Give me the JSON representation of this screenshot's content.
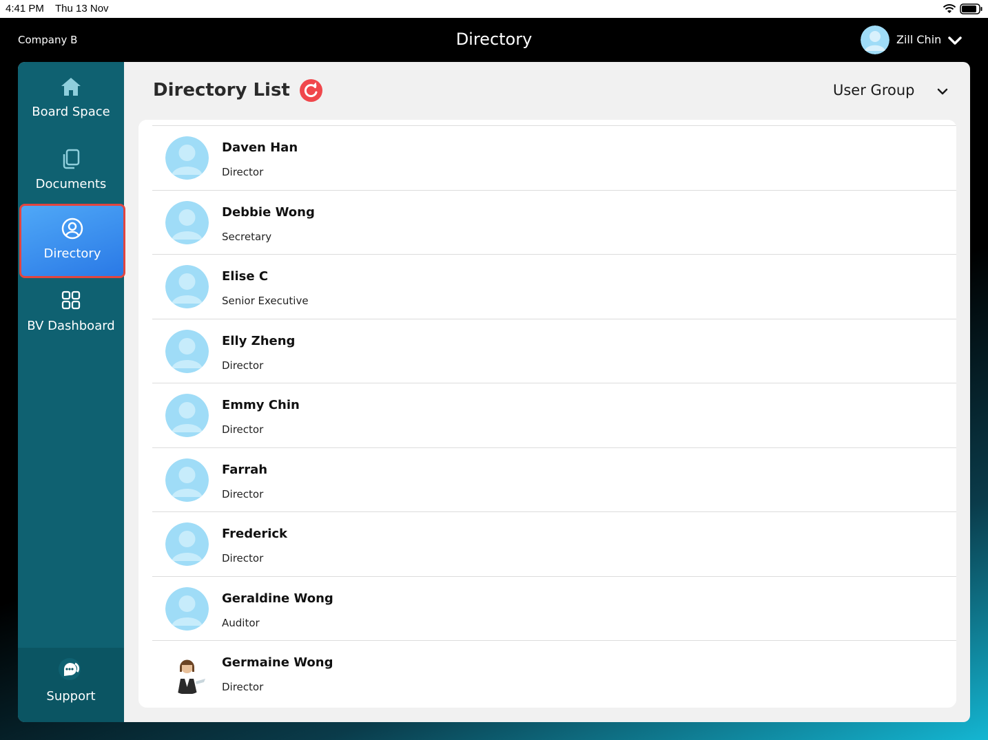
{
  "status_bar": {
    "time": "4:41 PM",
    "date": "Thu 13 Nov"
  },
  "header": {
    "company": "Company B",
    "title": "Directory",
    "user_name": "Zill Chin"
  },
  "sidebar": {
    "items": [
      {
        "label": "Board Space",
        "icon": "home-icon",
        "active": false
      },
      {
        "label": "Documents",
        "icon": "documents-icon",
        "active": false
      },
      {
        "label": "Directory",
        "icon": "user-circle-icon",
        "active": true
      },
      {
        "label": "BV Dashboard",
        "icon": "grid-icon",
        "active": false
      }
    ],
    "support_label": "Support"
  },
  "main": {
    "title": "Directory List",
    "filter_label": "User Group"
  },
  "directory": [
    {
      "name": "Daven Han",
      "role": "Director",
      "avatar": "default"
    },
    {
      "name": "Debbie Wong",
      "role": "Secretary",
      "avatar": "default"
    },
    {
      "name": "Elise C",
      "role": "Senior Executive",
      "avatar": "default"
    },
    {
      "name": "Elly Zheng",
      "role": "Director",
      "avatar": "default"
    },
    {
      "name": "Emmy Chin",
      "role": "Director",
      "avatar": "default"
    },
    {
      "name": "Farrah",
      "role": "Director",
      "avatar": "default"
    },
    {
      "name": "Frederick",
      "role": "Director",
      "avatar": "default"
    },
    {
      "name": "Geraldine Wong",
      "role": "Auditor",
      "avatar": "default"
    },
    {
      "name": "Germaine Wong",
      "role": "Director",
      "avatar": "photo"
    }
  ],
  "colors": {
    "sidebar": "#0f6171",
    "active_item": "#3a8ff0",
    "active_border": "#e2453f",
    "refresh": "#f0474c",
    "avatar": "#9fdcf7"
  }
}
